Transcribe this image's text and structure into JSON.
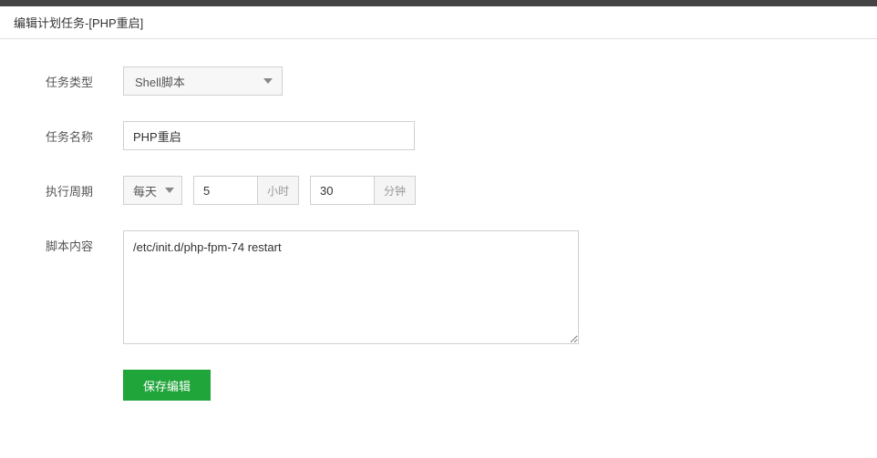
{
  "header": {
    "title": "编辑计划任务-[PHP重启]"
  },
  "form": {
    "taskType": {
      "label": "任务类型",
      "value": "Shell脚本"
    },
    "taskName": {
      "label": "任务名称",
      "value": "PHP重启"
    },
    "cycle": {
      "label": "执行周期",
      "frequency": "每天",
      "hourValue": "5",
      "hourSuffix": "小时",
      "minuteValue": "30",
      "minuteSuffix": "分钟"
    },
    "script": {
      "label": "脚本内容",
      "value": "/etc/init.d/php-fpm-74 restart"
    },
    "submit": {
      "label": "保存编辑"
    }
  }
}
